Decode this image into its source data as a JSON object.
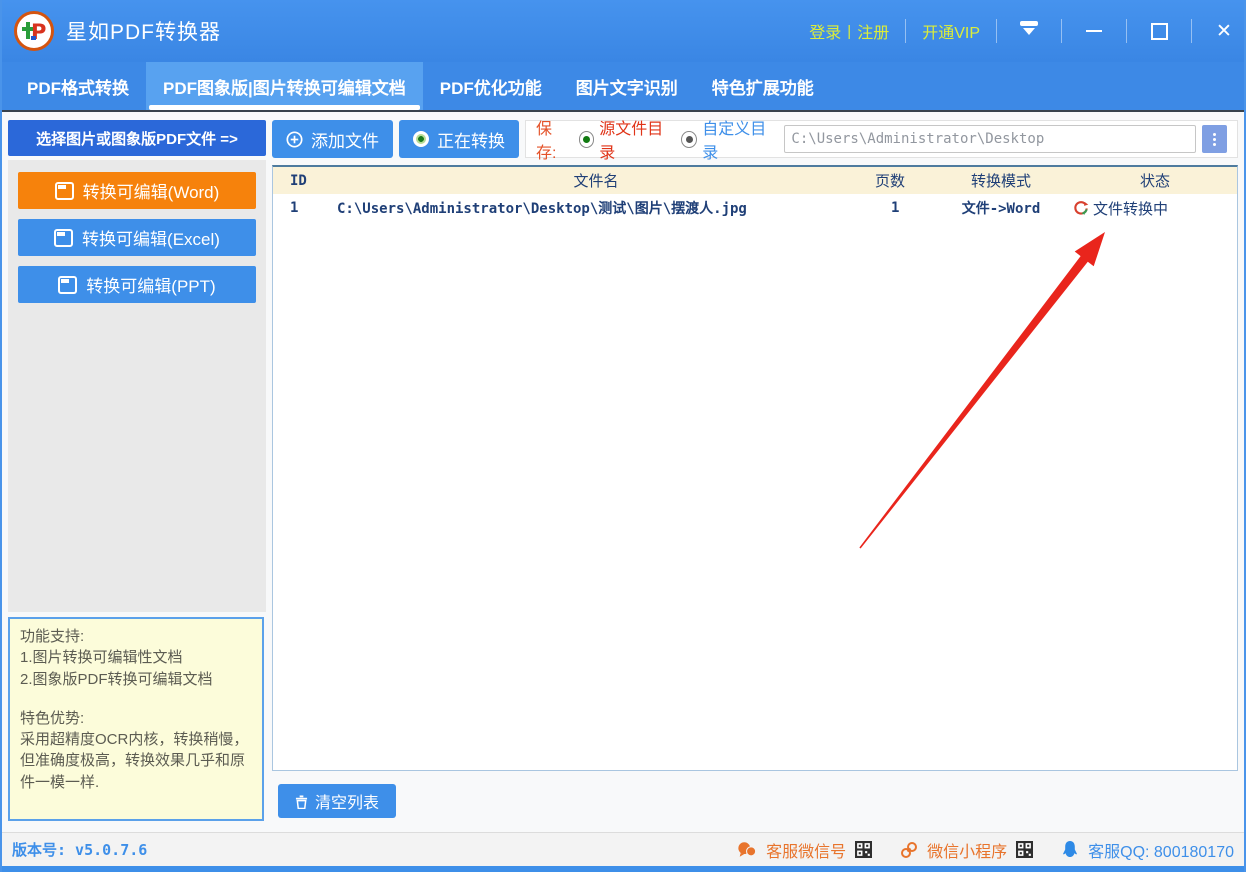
{
  "window": {
    "title": "星如PDF转换器"
  },
  "titlebar": {
    "login": "登录",
    "separator": "|",
    "register": "注册",
    "vip": "开通VIP"
  },
  "tabs": [
    {
      "label": "PDF格式转换",
      "active": false
    },
    {
      "label": "PDF图象版|图片转换可编辑文档",
      "active": true
    },
    {
      "label": "PDF优化功能",
      "active": false
    },
    {
      "label": "图片文字识别",
      "active": false
    },
    {
      "label": "特色扩展功能",
      "active": false
    }
  ],
  "left": {
    "select_header": "选择图片或图象版PDF文件 =>",
    "buttons": [
      {
        "label": "转换可编辑(Word)",
        "color": "#f6820c"
      },
      {
        "label": "转换可编辑(Excel)",
        "color": "#3e8fe9"
      },
      {
        "label": "转换可编辑(PPT)",
        "color": "#3e8fe9"
      }
    ],
    "info": {
      "lines": [
        "功能支持:",
        "1.图片转换可编辑性文档",
        "2.图象版PDF转换可编辑文档",
        "",
        "特色优势:",
        "采用超精度OCR内核，转换稍慢，但准确度极高，转换效果几乎和原件一模一样."
      ]
    }
  },
  "toolbar": {
    "add_file": "添加文件",
    "converting": "正在转换",
    "save_label": "保存:",
    "radio_source": "源文件目录",
    "radio_custom": "自定义目录",
    "path_value": "C:\\Users\\Administrator\\Desktop"
  },
  "table": {
    "columns": [
      "ID",
      "文件名",
      "页数",
      "转换模式",
      "状态"
    ],
    "rows": [
      {
        "id": "1",
        "filename": "C:\\Users\\Administrator\\Desktop\\测试\\图片\\摆渡人.jpg",
        "pages": "1",
        "mode": "文件->Word",
        "status": "文件转换中"
      }
    ]
  },
  "actions": {
    "clear_list": "清空列表"
  },
  "statusbar": {
    "version": "版本号: v5.0.7.6",
    "wechat_service": "客服微信号",
    "mini_program": "微信小程序",
    "qq_service": "客服QQ: 800180170"
  },
  "colors": {
    "titlebar_blue": "#3d89e6",
    "accent_blue": "#3e8fe9",
    "active_tab_blue": "#58a2f0",
    "select_header_blue": "#2b68d9",
    "word_orange": "#f6820c",
    "table_header_bg": "#faf2d8",
    "table_text_navy": "#1f3f77",
    "info_panel_bg": "#fcfcda",
    "titlebar_link_yellow": "#dced3a",
    "status_orange": "#e8742c",
    "annotation_red": "#e9251c"
  }
}
